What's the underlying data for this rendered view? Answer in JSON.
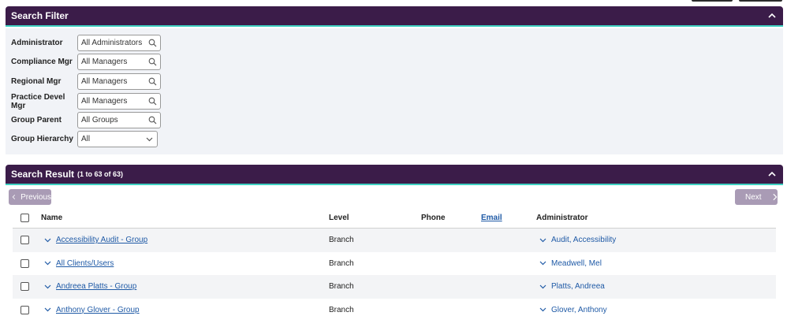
{
  "filter": {
    "title": "Search Filter",
    "fields": [
      {
        "label": "Administrator",
        "value": "All Administrators",
        "icon": "search-icon"
      },
      {
        "label": "Compliance Mgr",
        "value": "All Managers",
        "icon": "search-icon"
      },
      {
        "label": "Regional Mgr",
        "value": "All Managers",
        "icon": "search-icon"
      },
      {
        "label": "Practice Devel Mgr",
        "value": "All Managers",
        "icon": "search-icon"
      },
      {
        "label": "Group Parent",
        "value": "All Groups",
        "icon": "search-icon"
      },
      {
        "label": "Group Hierarchy",
        "value": "All",
        "icon": "chevron-down-icon"
      }
    ]
  },
  "results": {
    "title": "Search Result",
    "range": "(1 to 63 of 63)",
    "prev_label": "Previous",
    "next_label": "Next",
    "columns": {
      "name": "Name",
      "level": "Level",
      "phone": "Phone",
      "email": "Email",
      "administrator": "Administrator"
    },
    "rows": [
      {
        "name": "Accessibility Audit - Group",
        "level": "Branch",
        "phone": "",
        "administrator": "Audit, Accessibility"
      },
      {
        "name": "All Clients/Users",
        "level": "Branch",
        "phone": "",
        "administrator": "Meadwell, Mel"
      },
      {
        "name": "Andreea Platts - Group",
        "level": "Branch",
        "phone": "",
        "administrator": "Platts, Andreea"
      },
      {
        "name": "Anthony Glover - Group",
        "level": "Branch",
        "phone": "",
        "administrator": "Glover, Anthony"
      }
    ]
  },
  "colors": {
    "header": "#3b1c49",
    "accent": "#3fd1c2",
    "link": "#1f5aa6",
    "pager": "#a99bb5"
  }
}
